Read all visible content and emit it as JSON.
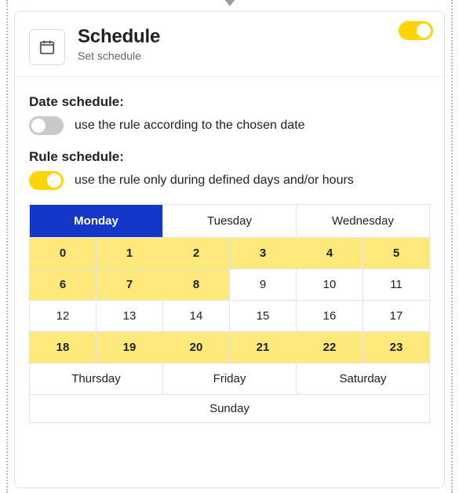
{
  "caret_color": "#9aa0a6",
  "header": {
    "title": "Schedule",
    "subtitle": "Set schedule",
    "master_toggle_on": true
  },
  "date_schedule": {
    "label": "Date schedule:",
    "toggle_on": false,
    "description": "use the rule according to the chosen date"
  },
  "rule_schedule": {
    "label": "Rule schedule:",
    "toggle_on": true,
    "description": "use the rule only during defined days and/or hours"
  },
  "days_top": [
    {
      "name": "Monday",
      "active": true
    },
    {
      "name": "Tuesday",
      "active": false
    },
    {
      "name": "Wednesday",
      "active": false
    }
  ],
  "hours": [
    "0",
    "1",
    "2",
    "3",
    "4",
    "5",
    "6",
    "7",
    "8",
    "9",
    "10",
    "11",
    "12",
    "13",
    "14",
    "15",
    "16",
    "17",
    "18",
    "19",
    "20",
    "21",
    "22",
    "23"
  ],
  "selected_hours": [
    "0",
    "1",
    "2",
    "3",
    "4",
    "5",
    "6",
    "7",
    "8",
    "18",
    "19",
    "20",
    "21",
    "22",
    "23"
  ],
  "days_bottom": [
    "Thursday",
    "Friday",
    "Saturday"
  ],
  "day_last": "Sunday"
}
